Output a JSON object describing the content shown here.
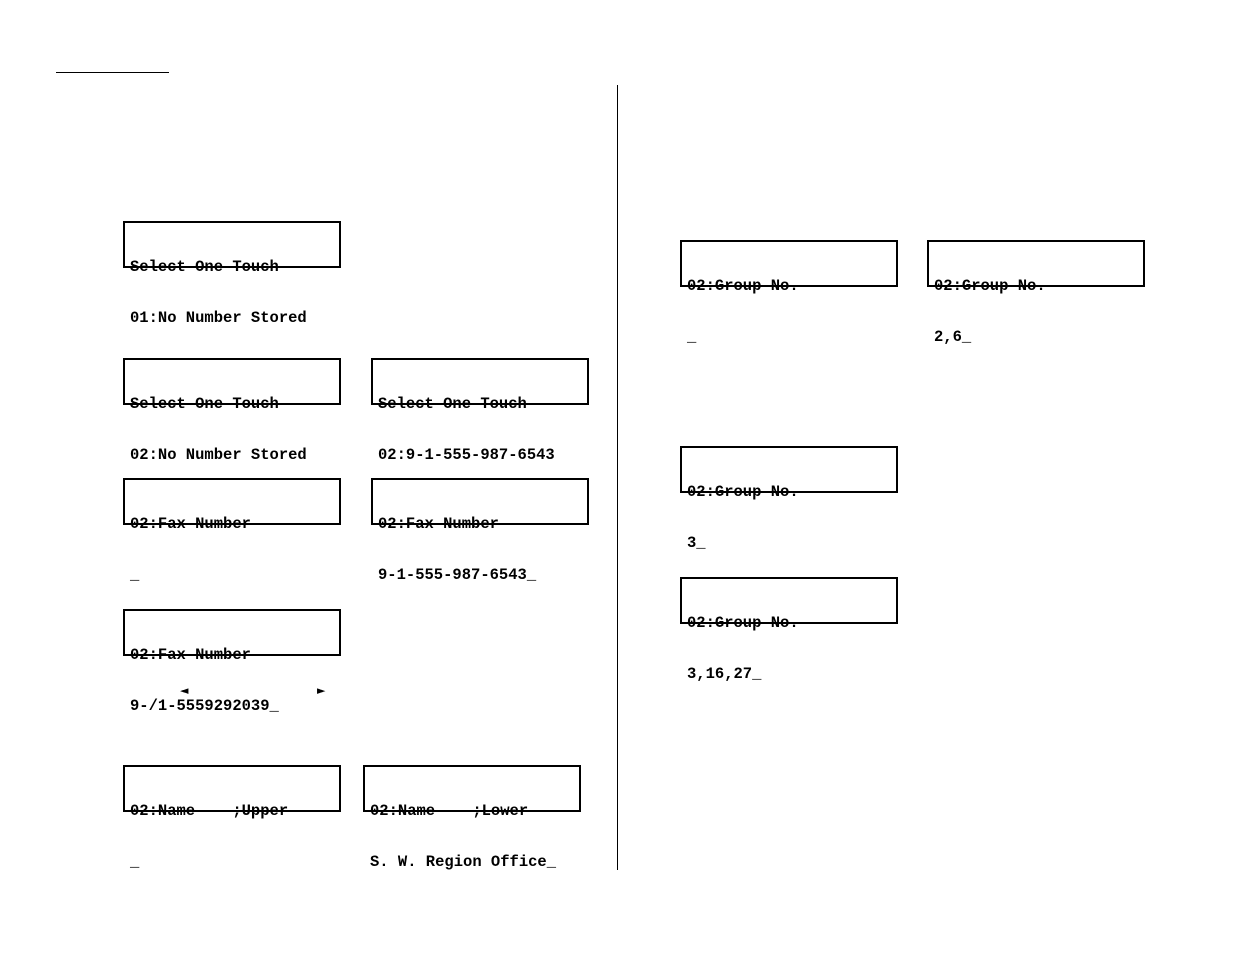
{
  "icons": {
    "left_arrow": "◄",
    "right_arrow": "►"
  },
  "left_column": {
    "displays": [
      {
        "name": "select-one-touch-01",
        "line1": "Select One-Touch",
        "line2": "01:No Number Stored"
      },
      {
        "name": "select-one-touch-02-empty",
        "line1": "Select One-Touch",
        "line2": "02:No Number Stored"
      },
      {
        "name": "select-one-touch-02-stored",
        "line1": "Select One-Touch",
        "line2": "02:9-1-555-987-6543"
      },
      {
        "name": "fax-number-empty",
        "line1": "02:Fax Number",
        "line2": "_"
      },
      {
        "name": "fax-number-entered",
        "line1": "02:Fax Number",
        "line2": "9-1-555-987-6543_"
      },
      {
        "name": "fax-number-pause",
        "line1": "02:Fax Number",
        "line2": "9-/1-5559292039_"
      },
      {
        "name": "name-upper-empty",
        "line1": "02:Name    ;Upper",
        "line2": "_"
      },
      {
        "name": "name-lower-entered",
        "line1": "02:Name    ;Lower",
        "line2": "S. W. Region Office_"
      }
    ]
  },
  "right_column": {
    "displays": [
      {
        "name": "group-no-empty",
        "line1": "02:Group No.",
        "line2": "_"
      },
      {
        "name": "group-no-2-6",
        "line1": "02:Group No.",
        "line2": "2,6_"
      },
      {
        "name": "group-no-3",
        "line1": "02:Group No.",
        "line2": "3_"
      },
      {
        "name": "group-no-3-16-27",
        "line1": "02:Group No.",
        "line2": "3,16,27_"
      }
    ]
  }
}
